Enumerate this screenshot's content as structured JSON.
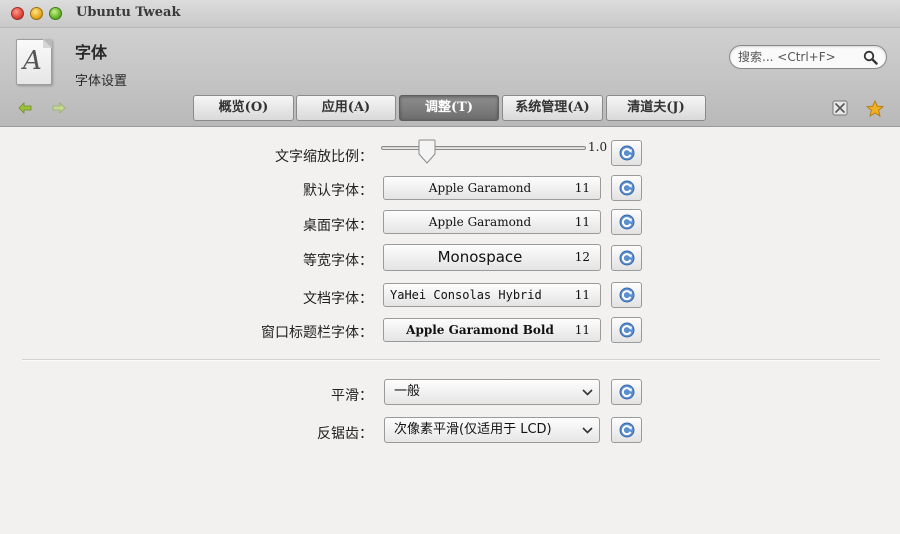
{
  "window": {
    "title": "Ubuntu Tweak"
  },
  "header": {
    "icon_letter": "A",
    "title": "字体",
    "subtitle": "字体设置"
  },
  "search": {
    "placeholder": "搜索... <Ctrl+F>"
  },
  "tabs": [
    {
      "label": "概览(O)",
      "active": false
    },
    {
      "label": "应用(A)",
      "active": false
    },
    {
      "label": "调整(T)",
      "active": true
    },
    {
      "label": "系统管理(A)",
      "active": false
    },
    {
      "label": "清道夫(J)",
      "active": false
    }
  ],
  "settings": {
    "text_scale": {
      "label": "文字缩放比例：",
      "value_text": "1.0",
      "slider_fraction": 0.23
    },
    "default_font": {
      "label": "默认字体：",
      "font": "Apple Garamond",
      "size": "11"
    },
    "desktop_font": {
      "label": "桌面字体：",
      "font": "Apple Garamond",
      "size": "11"
    },
    "monospace_font": {
      "label": "等宽字体：",
      "font": "Monospace",
      "size": "12"
    },
    "document_font": {
      "label": "文档字体：",
      "font": "YaHei Consolas Hybrid",
      "size": "11"
    },
    "titlebar_font": {
      "label": "窗口标题栏字体：",
      "font": "Apple Garamond Bold",
      "size": "11"
    },
    "smoothing": {
      "label": "平滑：",
      "value": "一般"
    },
    "antialiasing": {
      "label": "反锯齿：",
      "value": "次像素平滑(仅适用于 LCD)"
    }
  },
  "colors": {
    "active_tab": "#7a7a7a",
    "reset_icon": "#4a7fc0",
    "star": "#f0b020",
    "nav_arrow": "#9bc23a"
  }
}
